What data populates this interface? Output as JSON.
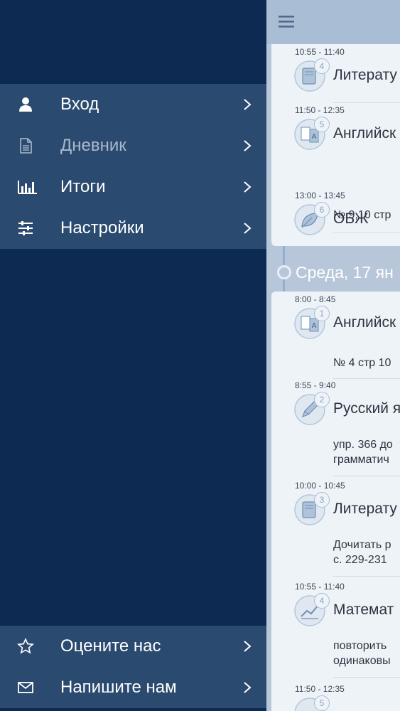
{
  "drawer": {
    "menu": [
      {
        "label": "Вход",
        "icon": "user-icon",
        "dim": false
      },
      {
        "label": "Дневник",
        "icon": "document-icon",
        "dim": true
      },
      {
        "label": "Итоги",
        "icon": "bar-chart-icon",
        "dim": false
      },
      {
        "label": "Настройки",
        "icon": "sliders-icon",
        "dim": false
      }
    ],
    "bottom_menu": [
      {
        "label": "Оцените нас",
        "icon": "star-icon"
      },
      {
        "label": "Напишите нам",
        "icon": "mail-icon"
      }
    ]
  },
  "schedule": {
    "day1": {
      "lessons": [
        {
          "time": "10:55 - 11:40",
          "num": "4",
          "subject": "Литерату",
          "homework": ""
        },
        {
          "time": "11:50 - 12:35",
          "num": "5",
          "subject": "Английск",
          "homework": "№ 9,10 стр"
        },
        {
          "time": "13:00 - 13:45",
          "num": "6",
          "subject": "ОБЖ",
          "homework": ""
        }
      ]
    },
    "day2": {
      "title": "Среда, 17 ян",
      "lessons": [
        {
          "time": "8:00 - 8:45",
          "num": "1",
          "subject": "Английск",
          "homework": "№ 4 стр 10"
        },
        {
          "time": "8:55 - 9:40",
          "num": "2",
          "subject": "Русский я",
          "homework_l1": "упр. 366 до",
          "homework_l2": "грамматич"
        },
        {
          "time": "10:00 - 10:45",
          "num": "3",
          "subject": "Литерату",
          "homework_l1": "Дочитать р",
          "homework_l2": "с. 229-231"
        },
        {
          "time": "10:55 - 11:40",
          "num": "4",
          "subject": "Математ",
          "homework_l1": "повторить",
          "homework_l2": "одинаковы"
        },
        {
          "time": "11:50 - 12:35",
          "num": "5"
        }
      ]
    }
  },
  "colors": {
    "drawer_bg": "#0d2b52",
    "menu_item_bg": "#2b4a70",
    "panel_bg": "#b7c7d9",
    "card_bg": "#eef3f8"
  }
}
